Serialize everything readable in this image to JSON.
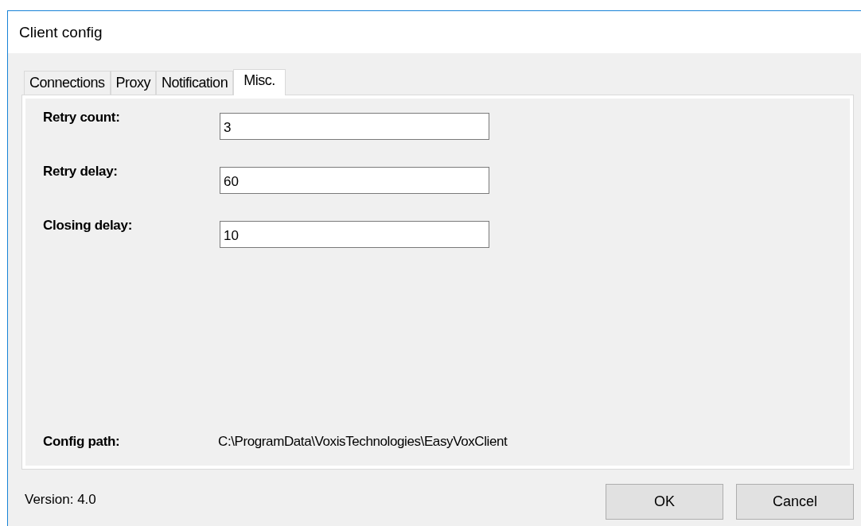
{
  "window": {
    "title": "Client config"
  },
  "tabs": [
    {
      "label": "Connections",
      "selected": false
    },
    {
      "label": "Proxy",
      "selected": false
    },
    {
      "label": "Notification",
      "selected": false
    },
    {
      "label": "Misc.",
      "selected": true
    }
  ],
  "fields": [
    {
      "label": "Retry count:",
      "value": "3"
    },
    {
      "label": "Retry delay:",
      "value": "60"
    },
    {
      "label": "Closing delay:",
      "value": "10"
    }
  ],
  "config_path": {
    "label": "Config path:",
    "value": "C:\\ProgramData\\VoxisTechnologies\\EasyVoxClient"
  },
  "version": "Version: 4.0",
  "buttons": [
    "OK",
    "Cancel"
  ]
}
